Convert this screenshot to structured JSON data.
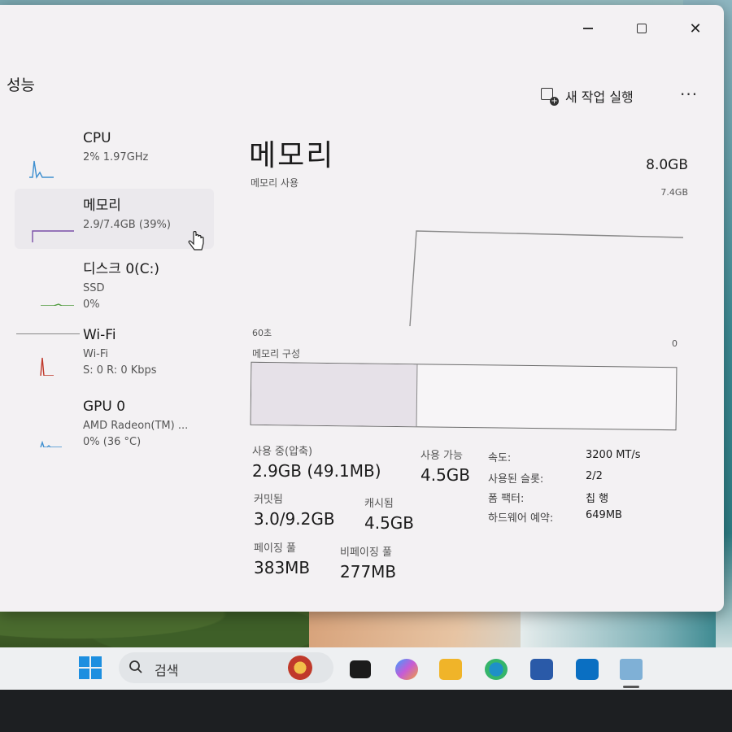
{
  "window": {
    "page_title": "성능",
    "controls": {
      "minimize": "minimize",
      "maximize": "maximize",
      "close": "✕"
    }
  },
  "toolbar": {
    "run_new_task_label": "새 작업 실행",
    "more_label": "···"
  },
  "sidebar": {
    "items": [
      {
        "name": "CPU",
        "sub1": "2% 1.97GHz",
        "sub2": "",
        "sub3": ""
      },
      {
        "name": "메모리",
        "sub1": "2.9/7.4GB (39%)",
        "sub2": "",
        "sub3": ""
      },
      {
        "name": "디스크 0(C:)",
        "sub1": "SSD",
        "sub2": "0%",
        "sub3": ""
      },
      {
        "name": "Wi-Fi",
        "sub1": "Wi-Fi",
        "sub2": "S: 0 R: 0 Kbps",
        "sub3": ""
      },
      {
        "name": "GPU 0",
        "sub1": "AMD Radeon(TM) ...",
        "sub2": "0% (36 °C)",
        "sub3": ""
      }
    ]
  },
  "main": {
    "title": "메모리",
    "subtitle": "메모리 사용",
    "total": "8.0GB",
    "graph_max": "7.4GB",
    "graph_time": "60초",
    "graph_zero": "0",
    "graph_usage_fraction": 0.39,
    "composition_label": "메모리 구성",
    "composition_in_use_fraction": 0.39,
    "stats": {
      "in_use_label": "사용 중(압축)",
      "in_use_value": "2.9GB (49.1MB)",
      "available_label": "사용 가능",
      "available_value": "4.5GB",
      "committed_label": "커밋됨",
      "committed_value": "3.0/9.2GB",
      "cached_label": "캐시됨",
      "cached_value": "4.5GB",
      "paged_label": "페이징 풀",
      "paged_value": "383MB",
      "nonpaged_label": "비페이징 풀",
      "nonpaged_value": "277MB"
    },
    "specs": [
      {
        "key": "속도:",
        "value": "3200 MT/s"
      },
      {
        "key": "사용된 슬롯:",
        "value": "2/2"
      },
      {
        "key": "폼 팩터:",
        "value": "칩 행"
      },
      {
        "key": "하드웨어 예약:",
        "value": "649MB"
      }
    ]
  },
  "taskbar": {
    "search_label": "검색",
    "accent": "#1d8fe0"
  }
}
